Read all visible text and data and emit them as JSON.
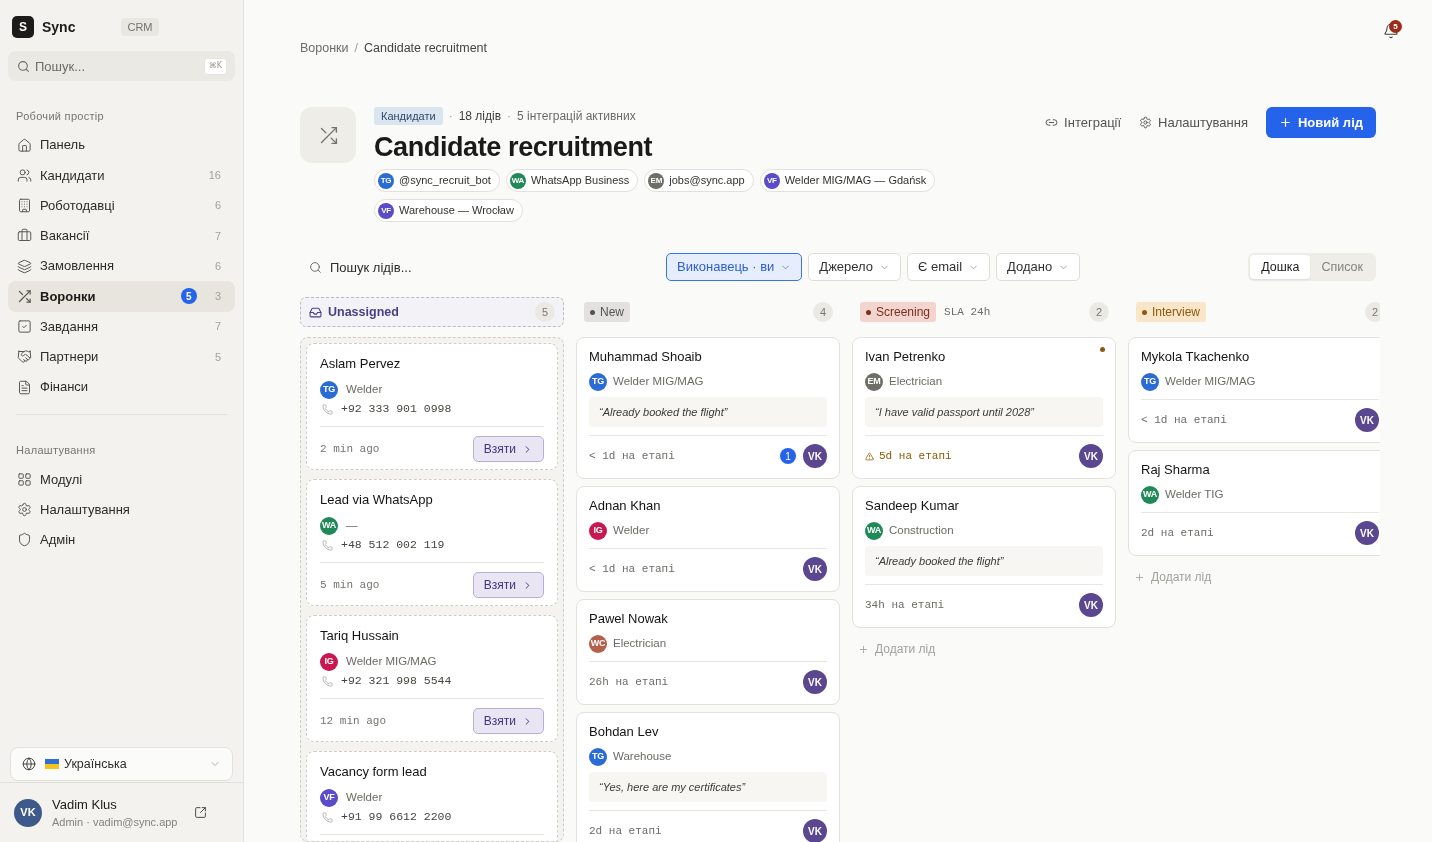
{
  "sidebar": {
    "brand": {
      "logo": "S",
      "name": "Sync",
      "badge": "CRM"
    },
    "search": {
      "placeholder": "Пошук...",
      "shortcut": "⌘K"
    },
    "sections": [
      {
        "title": "Робочий простір",
        "items": [
          {
            "label": "Панель",
            "selected": false
          },
          {
            "label": "Кандидати",
            "count": "16",
            "selected": false
          },
          {
            "label": "Роботодавці",
            "count": "6",
            "selected": false
          },
          {
            "label": "Вакансії",
            "count": "7",
            "selected": false
          },
          {
            "label": "Замовлення",
            "count": "6",
            "selected": false
          },
          {
            "label": "Воронки",
            "badge": "5",
            "count": "3",
            "selected": true
          },
          {
            "label": "Завдання",
            "count": "7",
            "selected": false
          },
          {
            "label": "Партнери",
            "count": "5",
            "selected": false
          },
          {
            "label": "Фінанси",
            "selected": false
          }
        ]
      },
      {
        "title": "Налаштування",
        "items": [
          {
            "label": "Модулі",
            "selected": false
          },
          {
            "label": "Налаштування",
            "selected": false
          },
          {
            "label": "Адмін",
            "selected": false
          }
        ]
      }
    ],
    "language": {
      "label": "Українська"
    },
    "user": {
      "initials": "VK",
      "name": "Vadim Klus",
      "subtitle": "Admin · vadim@sync.app"
    }
  },
  "breadcrumb": {
    "items": [
      "Воронки",
      "Candidate recruitment"
    ],
    "separator": "/"
  },
  "notifications": {
    "count": "5"
  },
  "header": {
    "tag": "Кандидати",
    "separator": "·",
    "meta": [
      "18 лідів",
      "5 інтеграцій активних"
    ],
    "title": "Candidate recruitment",
    "sources": [
      {
        "initials": "TG",
        "label": "@sync_recruit_bot",
        "color": "#2b6cd4"
      },
      {
        "initials": "WA",
        "label": "WhatsApp Business",
        "color": "#1f8a57"
      },
      {
        "initials": "EM",
        "label": "jobs@sync.app",
        "color": "#6e6d68"
      },
      {
        "initials": "VF",
        "label": "Welder MIG/MAG — Gdańsk",
        "color": "#5a4bc8"
      },
      {
        "initials": "VF",
        "label": "Warehouse — Wrocław",
        "color": "#5a4bc8"
      }
    ],
    "actions": [
      {
        "kind": "ghost",
        "label": "Інтеграції"
      },
      {
        "kind": "ghost",
        "label": "Налаштування"
      },
      {
        "kind": "primary",
        "label": "Новий лід"
      }
    ]
  },
  "toolbar": {
    "search": {
      "placeholder": "Пошук лідів..."
    },
    "filters": [
      {
        "label": "Виконавець · ви",
        "selected": true
      },
      {
        "label": "Джерело",
        "selected": false
      },
      {
        "label": "Є email",
        "selected": false
      },
      {
        "label": "Додано",
        "selected": false
      }
    ],
    "views": [
      {
        "label": "Дошка",
        "selected": true
      },
      {
        "label": "Список",
        "selected": false
      }
    ]
  },
  "board": {
    "columns": [
      {
        "kind": "unassigned",
        "title": "Unassigned",
        "count": "5",
        "cards": [
          {
            "name": "Aslam Pervez",
            "source": {
              "initials": "TG",
              "color": "#2b6cd4"
            },
            "role": "Welder",
            "phone": "+92 333 901 0998",
            "time": "2 min ago",
            "action": "Взяти"
          },
          {
            "name": "Lead via WhatsApp",
            "source": {
              "initials": "WA",
              "color": "#1f8a57"
            },
            "role": "—",
            "phone": "+48 512 002 119",
            "time": "5 min ago",
            "action": "Взяти"
          },
          {
            "name": "Tariq Hussain",
            "source": {
              "initials": "IG",
              "color": "#c8184f"
            },
            "role": "Welder MIG/MAG",
            "phone": "+92 321 998 5544",
            "time": "12 min ago",
            "action": "Взяти"
          },
          {
            "name": "Vacancy form lead",
            "source": {
              "initials": "VF",
              "color": "#5a4bc8"
            },
            "role": "Welder",
            "phone": "+91 99 6612 2200"
          }
        ]
      },
      {
        "kind": "stage",
        "title": "New",
        "color": "#55534e",
        "count": "4",
        "cards": [
          {
            "name": "Muhammad Shoaib",
            "source": {
              "initials": "TG",
              "color": "#2b6cd4"
            },
            "role": "Welder MIG/MAG",
            "quote": "“Already booked the flight”",
            "time": "< 1d на етапі",
            "overdue": false,
            "attention": false,
            "messages": "1",
            "assignee": "VK"
          },
          {
            "name": "Adnan Khan",
            "source": {
              "initials": "IG",
              "color": "#c8184f"
            },
            "role": "Welder",
            "time": "< 1d на етапі",
            "overdue": false,
            "attention": false,
            "assignee": "VK"
          },
          {
            "name": "Pawel Nowak",
            "source": {
              "initials": "WC",
              "color": "#b5604a"
            },
            "role": "Electrician",
            "time": "26h на етапі",
            "overdue": false,
            "attention": false,
            "assignee": "VK"
          },
          {
            "name": "Bohdan Lev",
            "source": {
              "initials": "TG",
              "color": "#2b6cd4"
            },
            "role": "Warehouse",
            "quote": "“Yes, here are my certificates”",
            "time": "2d на етапі",
            "overdue": false,
            "attention": false,
            "assignee": "VK"
          }
        ]
      },
      {
        "kind": "stage",
        "title": "Screening",
        "color": "#7a2e1e",
        "sla": "SLA 24h",
        "count": "2",
        "add_label": "Додати лід",
        "cards": [
          {
            "name": "Ivan Petrenko",
            "source": {
              "initials": "EM",
              "color": "#6e6d68"
            },
            "role": "Electrician",
            "quote": "“I have valid passport until 2028”",
            "time": "5d на етапі",
            "overdue": true,
            "attention": true,
            "assignee": "VK"
          },
          {
            "name": "Sandeep Kumar",
            "source": {
              "initials": "WA",
              "color": "#1f8a57"
            },
            "role": "Construction",
            "quote": "“Already booked the flight”",
            "time": "34h на етапі",
            "overdue": false,
            "attention": false,
            "assignee": "VK"
          }
        ]
      },
      {
        "kind": "stage",
        "title": "Interview",
        "color": "#8a5a10",
        "count": "2",
        "add_label": "Додати лід",
        "cards": [
          {
            "name": "Mykola Tkachenko",
            "source": {
              "initials": "TG",
              "color": "#2b6cd4"
            },
            "role": "Welder MIG/MAG",
            "time": "< 1d на етапі",
            "overdue": false,
            "attention": false,
            "assignee": "VK"
          },
          {
            "name": "Raj Sharma",
            "source": {
              "initials": "WA",
              "color": "#1f8a57"
            },
            "role": "Welder TIG",
            "time": "2d на етапі",
            "overdue": false,
            "attention": false,
            "assignee": "VK"
          }
        ]
      }
    ]
  }
}
